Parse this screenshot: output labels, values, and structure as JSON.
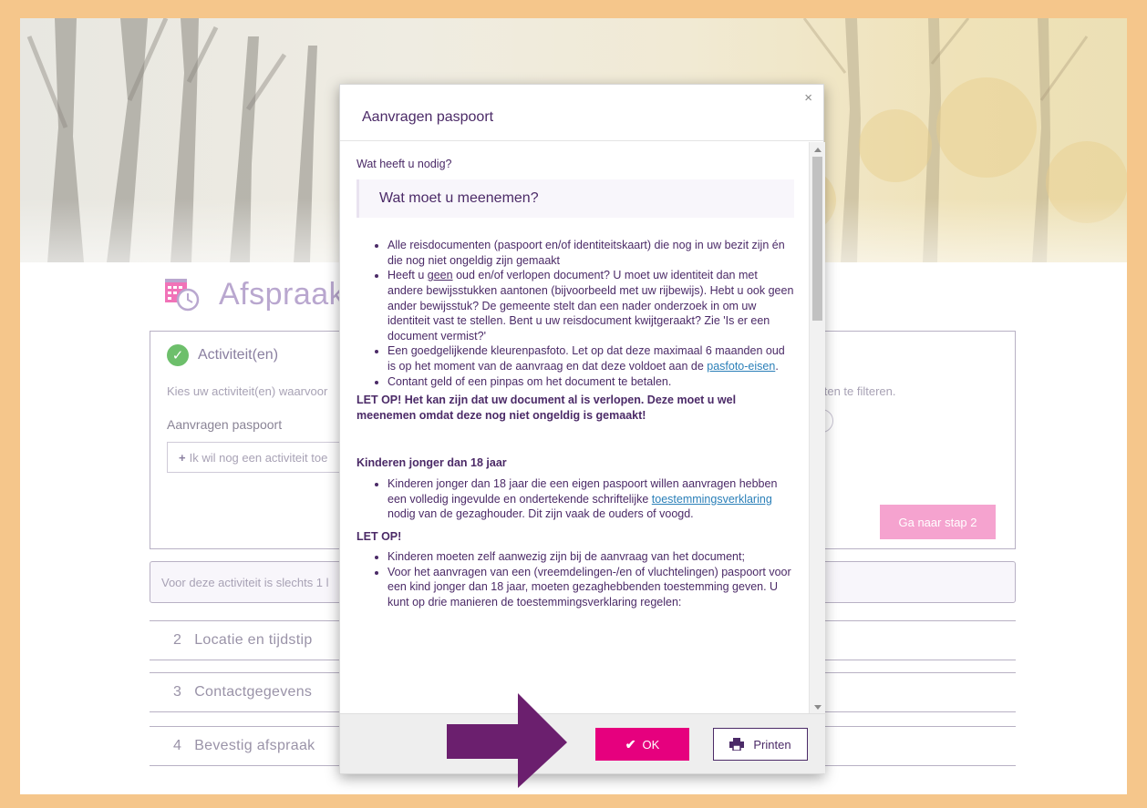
{
  "page": {
    "title": "Afspraak",
    "step1_title": "Activiteit(en)",
    "step1_desc": "Kies uw activiteit(en) waarvoor",
    "step1_desc_right": "teiten te filteren.",
    "selected_activity": "Aanvragen paspoort",
    "add_activity": "Ik wil nog een activiteit toe",
    "next_button": "Ga naar stap 2",
    "info_text": "Voor deze activiteit is slechts 1 l",
    "steps": [
      {
        "num": "2",
        "label": "Locatie en tijdstip"
      },
      {
        "num": "3",
        "label": "Contactgegevens"
      },
      {
        "num": "4",
        "label": "Bevestig afspraak"
      }
    ]
  },
  "modal": {
    "title": "Aanvragen paspoort",
    "close": "×",
    "intro": "Wat heeft u nodig?",
    "callout": "Wat moet u meenemen?",
    "list1": {
      "item1": "Alle reisdocumenten (paspoort en/of identiteitskaart) die nog in uw bezit zijn én die nog niet ongeldig zijn gemaakt",
      "item2_pre": "Heeft u ",
      "item2_u": "geen",
      "item2_post": " oud en/of verlopen document? U moet uw identiteit dan met andere bewijsstukken aantonen (bijvoorbeeld met uw rijbewijs). Hebt u ook geen ander bewijsstuk? De gemeente stelt dan een nader onderzoek in om uw identiteit vast te stellen. Bent u uw reisdocument kwijtgeraakt? Zie 'Is er een document vermist?'",
      "item3_pre": "Een goedgelijkende kleurenpasfoto. Let op dat deze maximaal 6 maanden oud is op het moment van de aanvraag en dat deze voldoet aan de ",
      "item3_link": "pasfoto-eisen",
      "item3_post": ".",
      "item4": "Contant geld of een pinpas om het document te betalen."
    },
    "warning1": "LET OP! Het kan zijn dat uw document al is verlopen. Deze moet u wel meenemen omdat deze nog niet ongeldig is gemaakt!",
    "subhead": "Kinderen jonger dan 18 jaar",
    "list2": {
      "item1_pre": "Kinderen jonger dan 18 jaar die een eigen paspoort willen aanvragen hebben een volledig ingevulde en ondertekende schriftelijke ",
      "item1_link": "toestemmingsverklaring",
      "item1_post": " nodig van de gezaghouder. Dit zijn vaak de ouders of voogd."
    },
    "warning2": "LET OP!",
    "list3": {
      "item1": "Kinderen moeten zelf aanwezig zijn bij de aanvraag van het document;",
      "item2": "Voor het aanvragen van een (vreemdelingen-/en of vluchtelingen) paspoort voor een kind jonger dan 18 jaar, moeten gezaghebbenden toestemming geven. U kunt op drie manieren de toestemmingsverklaring regelen:"
    },
    "ok_label": "OK",
    "print_label": "Printen"
  },
  "colors": {
    "frame": "#f5c68b",
    "accent": "#e6007e",
    "purple": "#4b2a67",
    "arrow": "#6b1f6e"
  }
}
